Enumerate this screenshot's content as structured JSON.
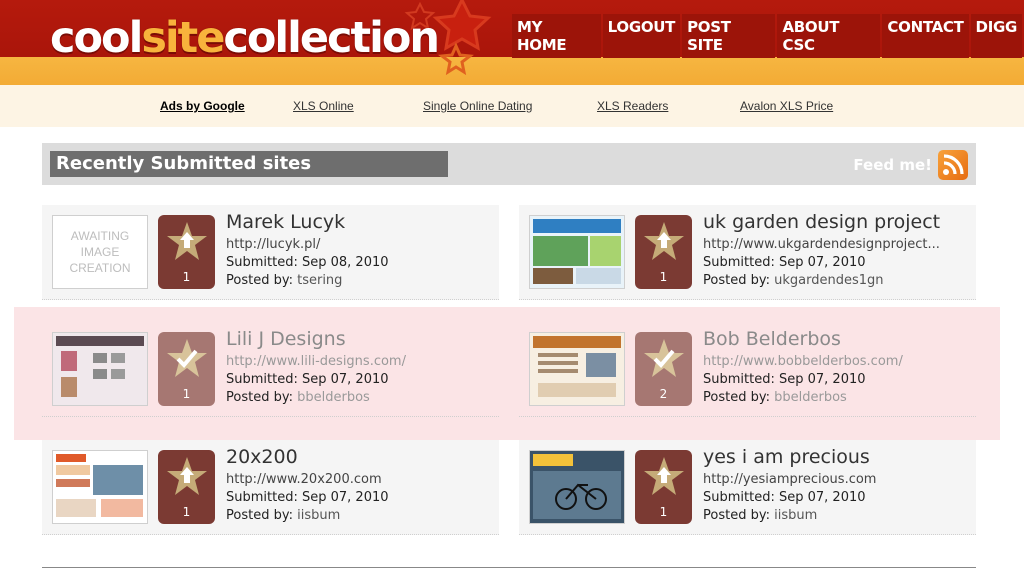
{
  "logo": {
    "part1": "cool",
    "part2": "site",
    "part3": "collection"
  },
  "nav": {
    "items": [
      "MY HOME",
      "LOGOUT",
      "POST SITE",
      "ABOUT CSC",
      "CONTACT",
      "DIGG"
    ]
  },
  "ads": {
    "items": [
      "Ads by Google",
      "XLS Online",
      "Single Online Dating",
      "XLS Readers",
      "Avalon XLS Price"
    ]
  },
  "section": {
    "title": "Recently Submitted sites",
    "feed_label": "Feed me!"
  },
  "labels": {
    "submitted": "Submitted:",
    "posted_by": "Posted by:"
  },
  "sites": [
    {
      "title": "Marek Lucyk",
      "url": "http://lucyk.pl/",
      "date": "Sep 08, 2010",
      "user": "tsering",
      "votes": "1",
      "thumb": "AWAITING IMAGE CREATION",
      "voted": false
    },
    {
      "title": "uk garden design project",
      "url": "http://www.ukgardendesignproject...",
      "date": "Sep 07, 2010",
      "user": "ukgardendes1gn",
      "votes": "1",
      "thumb": "",
      "voted": false
    },
    {
      "title": "Lili J Designs",
      "url": "http://www.lili-designs.com/",
      "date": "Sep 07, 2010",
      "user": "bbelderbos",
      "votes": "1",
      "thumb": "",
      "voted": true
    },
    {
      "title": "Bob Belderbos",
      "url": "http://www.bobbelderbos.com/",
      "date": "Sep 07, 2010",
      "user": "bbelderbos",
      "votes": "2",
      "thumb": "",
      "voted": true
    },
    {
      "title": "20x200",
      "url": "http://www.20x200.com",
      "date": "Sep 07, 2010",
      "user": "iisbum",
      "votes": "1",
      "thumb": "",
      "voted": false
    },
    {
      "title": "yes i am precious",
      "url": "http://yesiamprecious.com",
      "date": "Sep 07, 2010",
      "user": "iisbum",
      "votes": "1",
      "thumb": "",
      "voted": false
    }
  ]
}
